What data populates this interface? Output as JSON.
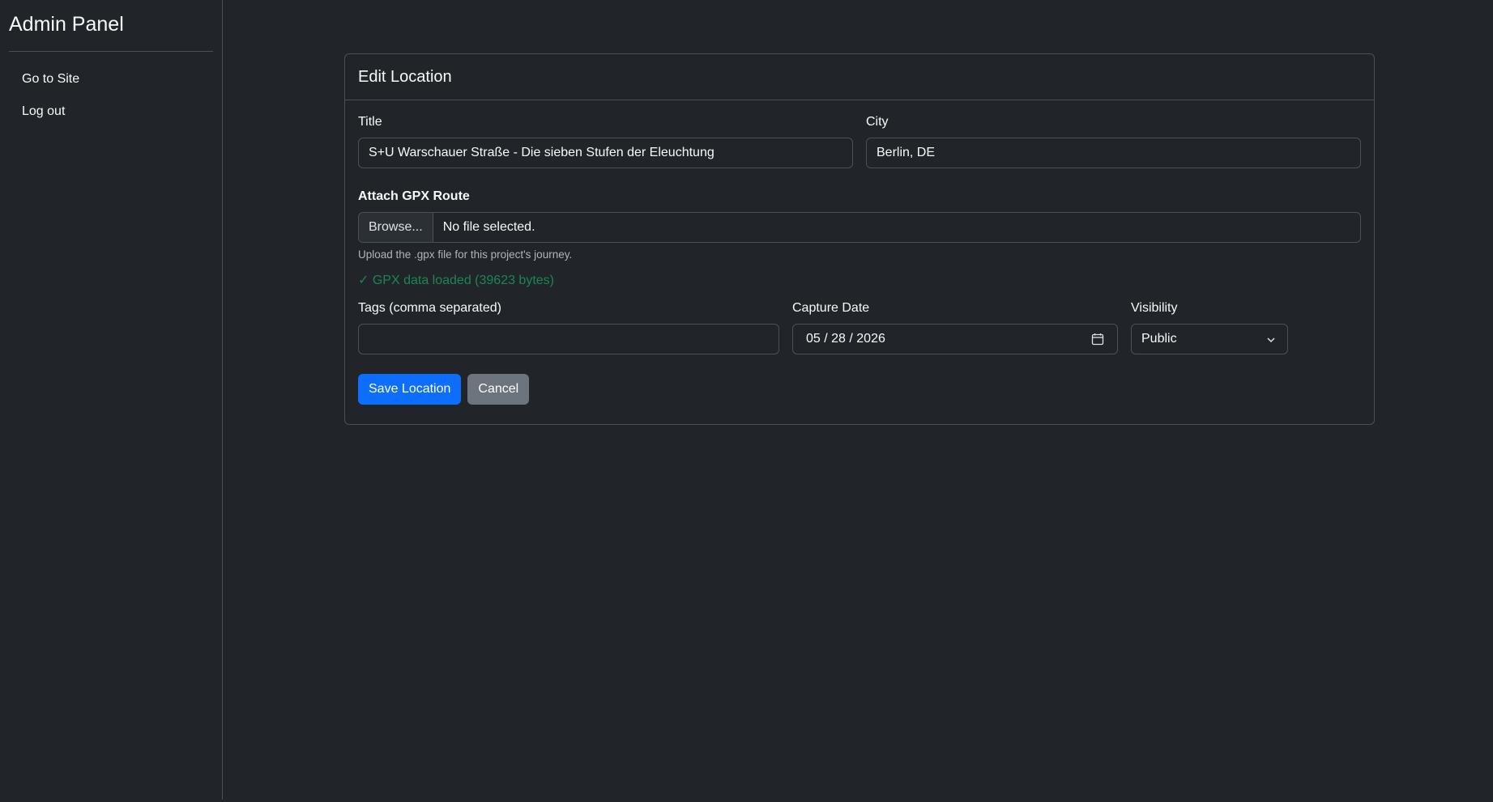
{
  "sidebar": {
    "brand": "Admin Panel",
    "items": [
      {
        "label": "Go to Site"
      },
      {
        "label": "Log out"
      }
    ]
  },
  "card": {
    "title": "Edit Location",
    "fields": {
      "title": {
        "label": "Title",
        "value": "S+U Warschauer Straße - Die sieben Stufen der Eleuchtung"
      },
      "city": {
        "label": "City",
        "value": "Berlin, DE"
      },
      "gpx": {
        "label": "Attach GPX Route",
        "browse_label": "Browse...",
        "file_status": "No file selected.",
        "help": "Upload the .gpx file for this project's journey.",
        "loaded_status": "✓ GPX data loaded (39623 bytes)"
      },
      "tags": {
        "label": "Tags (comma separated)",
        "value": ""
      },
      "capture_date": {
        "label": "Capture Date",
        "value": "05 / 28 / 2026"
      },
      "visibility": {
        "label": "Visibility",
        "value": "Public"
      }
    },
    "buttons": {
      "save": "Save Location",
      "cancel": "Cancel"
    }
  },
  "colors": {
    "background": "#212529",
    "border": "#495057",
    "primary": "#0d6efd",
    "secondary": "#6c757d",
    "success": "#198754"
  },
  "icons": {
    "date_picker": "calendar-icon",
    "select": "chevron-down-icon"
  }
}
